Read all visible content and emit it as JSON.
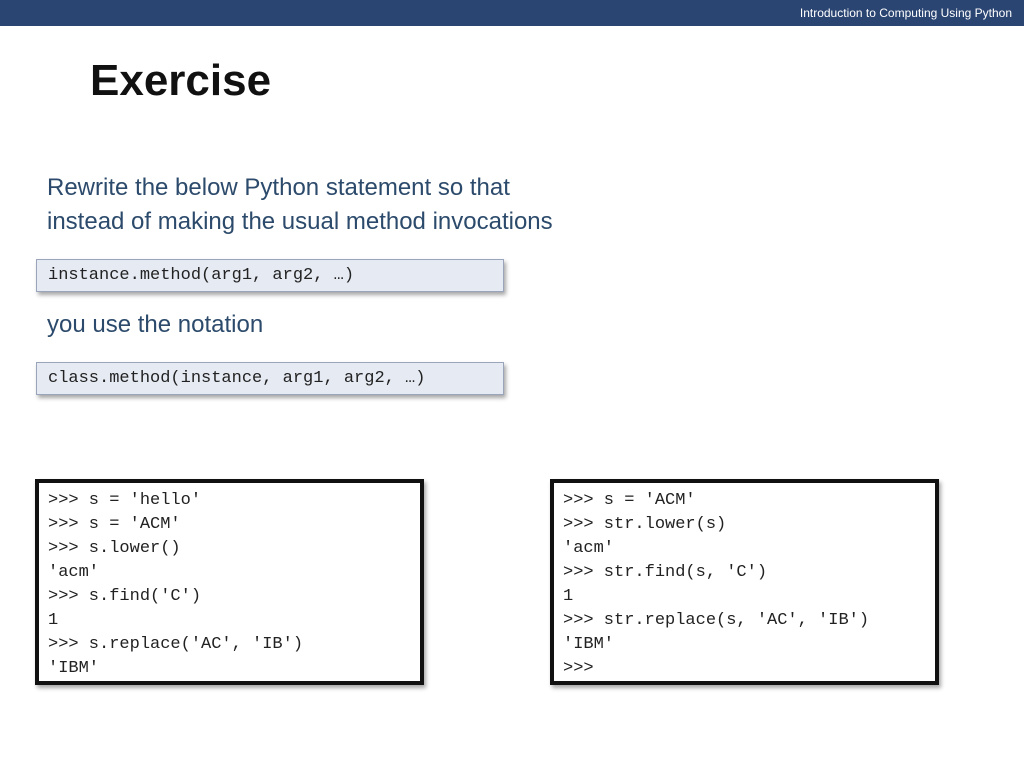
{
  "header": {
    "course_title": "Introduction to Computing Using Python"
  },
  "slide": {
    "title": "Exercise",
    "intro_line_1": "Rewrite the below Python statement so that",
    "intro_line_2": "instead of making the usual method invocations",
    "usual_invocation": "instance.method(arg1, arg2, …)",
    "notation_text": "you use the notation",
    "class_notation": "class.method(instance, arg1, arg2, …)"
  },
  "left_shell": {
    "lines": [
      ">>> s = 'hello'",
      ">>> s = 'ACM'",
      ">>> s.lower()",
      "'acm'",
      ">>> s.find('C')",
      "1",
      ">>> s.replace('AC', 'IB')",
      "'IBM'"
    ]
  },
  "right_shell": {
    "lines": [
      ">>> s = 'ACM'",
      ">>> str.lower(s)",
      "'acm'",
      ">>> str.find(s, 'C')",
      "1",
      ">>> str.replace(s, 'AC', 'IB')",
      "'IBM'",
      ">>>"
    ]
  },
  "colors": {
    "header_bar": "#2b4572",
    "body_text": "#2c4a6b",
    "code_banner_bg": "#e6eaf3"
  }
}
